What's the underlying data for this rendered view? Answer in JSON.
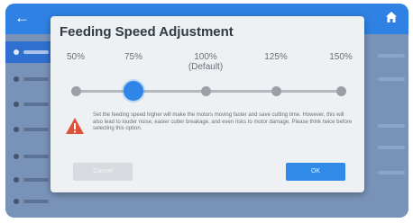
{
  "app": {
    "back_icon": "arrow-left-icon",
    "home_icon": "home-icon",
    "header_color": "#2f82e3"
  },
  "dialog": {
    "title": "Feeding Speed Adjustment",
    "speed_options": [
      {
        "label": "50%",
        "sub": ""
      },
      {
        "label": "75%",
        "sub": ""
      },
      {
        "label": "100%",
        "sub": "(Default)"
      },
      {
        "label": "125%",
        "sub": ""
      },
      {
        "label": "150%",
        "sub": ""
      }
    ],
    "selected_speed": "75%",
    "warning_icon": "warning-icon",
    "warning_text": "Set the feeding speed higher will make the motors moving faster and save cutting time. However, this will also lead to louder noise, easier cutter breakage, and even risks to motor damage. Please think twice before selecting this option.",
    "cancel_label": "Cancel",
    "ok_label": "OK",
    "accent_color": "#2f86e8",
    "warning_color": "#e0513a"
  }
}
